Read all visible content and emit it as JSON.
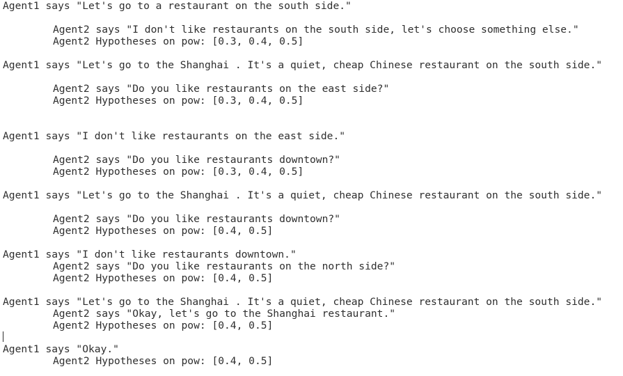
{
  "terminal": {
    "lines": [
      "Agent1 says \"Let's go to a restaurant on the south side.\"",
      "Agent2 says \"I don't like restaurants on the south side, let's choose something else.\"",
      "Agent2 Hypotheses on pow: [0.3, 0.4, 0.5]",
      "Agent1 says \"Let's go to the Shanghai . It's a quiet, cheap Chinese restaurant on the south side.\"",
      "Agent2 says \"Do you like restaurants on the east side?\"",
      "Agent2 Hypotheses on pow: [0.3, 0.4, 0.5]",
      "Agent1 says \"I don't like restaurants on the east side.\"",
      "Agent2 says \"Do you like restaurants downtown?\"",
      "Agent2 Hypotheses on pow: [0.3, 0.4, 0.5]",
      "Agent1 says \"Let's go to the Shanghai . It's a quiet, cheap Chinese restaurant on the south side.\"",
      "Agent2 says \"Do you like restaurants downtown?\"",
      "Agent2 Hypotheses on pow: [0.4, 0.5]",
      "Agent1 says \"I don't like restaurants downtown.\"",
      "Agent2 says \"Do you like restaurants on the north side?\"",
      "Agent2 Hypotheses on pow: [0.4, 0.5]",
      "Agent1 says \"Let's go to the Shanghai . It's a quiet, cheap Chinese restaurant on the south side.\"",
      "Agent2 says \"Okay, let's go to the Shanghai restaurant.\"",
      "Agent2 Hypotheses on pow: [0.4, 0.5]",
      "Agent1 says \"Okay.\"",
      "Agent2 Hypotheses on pow: [0.4, 0.5]"
    ]
  }
}
